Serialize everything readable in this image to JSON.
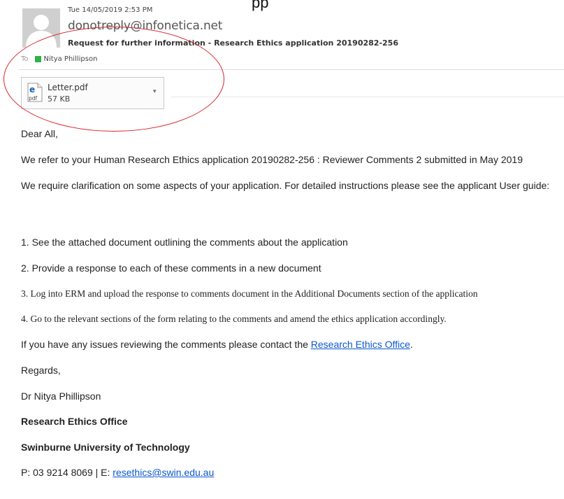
{
  "top_clip_text": "pp",
  "header": {
    "date": "Tue 14/05/2019 2:53 PM",
    "from": "donotreply@infonetica.net",
    "subject": "Request for further information - Research Ethics application 20190282-256",
    "to_prefix": "To",
    "to_name": "Nitya Phillipson",
    "to_color": "#2db34a"
  },
  "attachment": {
    "name": "Letter.pdf",
    "size": "57 KB",
    "icon_label": "pdf",
    "icon_glyph": "e",
    "chevron": "▾"
  },
  "body": {
    "greeting": "Dear All,",
    "line1": "We refer to your Human Research Ethics application  20190282-256  : Reviewer Comments 2  submitted in May  2019",
    "line2": "We require clarification on some aspects of your application. For detailed instructions please see the applicant User guide:",
    "step1": "1. See the attached document outlining the comments about the application",
    "step2": "2. Provide a response to each of these comments in a new document",
    "step3": "3. Log into ERM and upload the response to comments document in the Additional Documents section of the application",
    "step4": "4. Go to the relevant sections of the form relating to the comments and amend the ethics application accordingly.",
    "issues_prefix": "If you have any issues reviewing the comments please contact the ",
    "issues_link": "Research Ethics Office",
    "issues_suffix": ".",
    "regards": "Regards,",
    "signer": "Dr Nitya Phillipson",
    "office": "Research Ethics Office",
    "university": "Swinburne University of Technology",
    "contact_prefix": "P: 03 9214 8069 | E: ",
    "contact_email": "resethics@swin.edu.au"
  },
  "colors": {
    "link": "#0b57d0",
    "annotation_circle": "#d9232b"
  }
}
